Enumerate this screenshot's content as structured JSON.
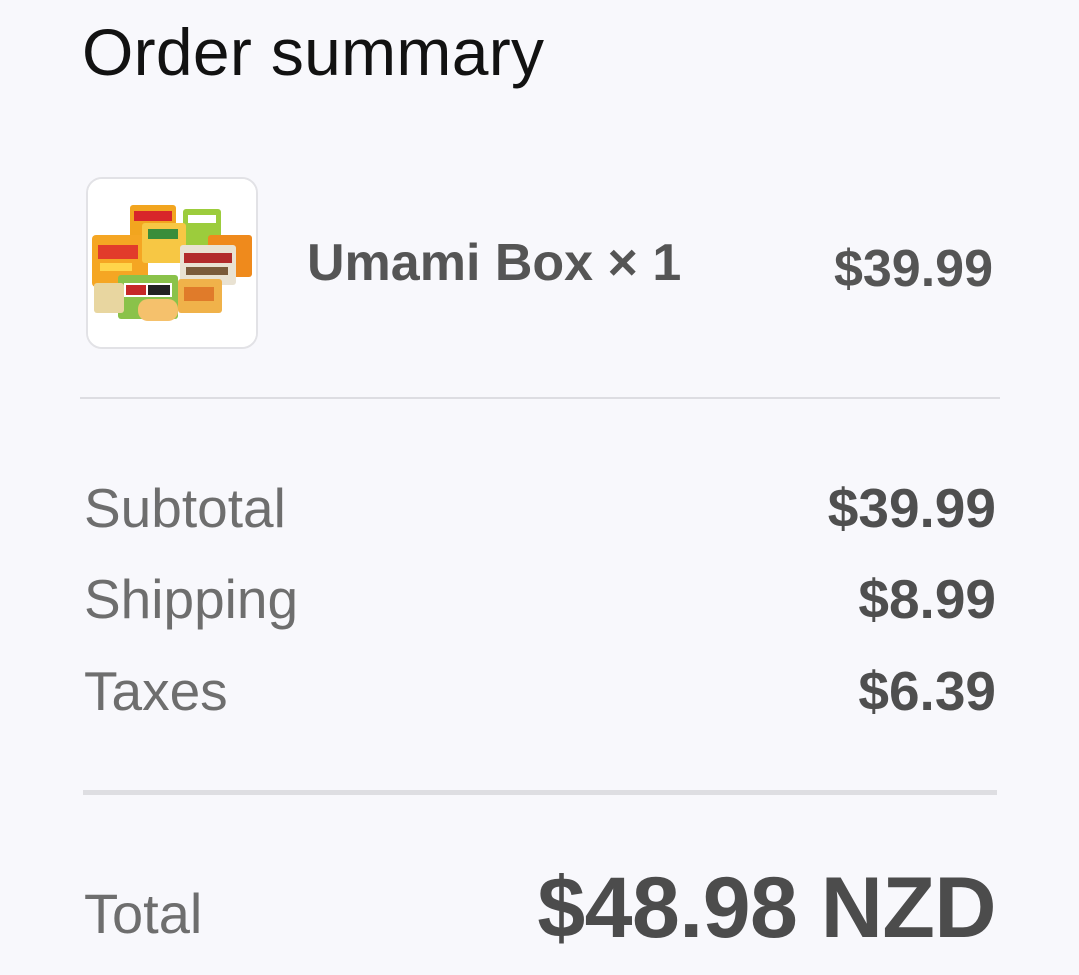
{
  "header": {
    "title": "Order summary"
  },
  "line_item": {
    "image_icon": "instant-noodle-packets-image",
    "name": "Umami Box × 1",
    "price": "$39.99"
  },
  "costs": {
    "subtotal_label": "Subtotal",
    "subtotal_value": "$39.99",
    "shipping_label": "Shipping",
    "shipping_value": "$8.99",
    "taxes_label": "Taxes",
    "taxes_value": "$6.39"
  },
  "total": {
    "label": "Total",
    "value": "$48.98 NZD"
  }
}
